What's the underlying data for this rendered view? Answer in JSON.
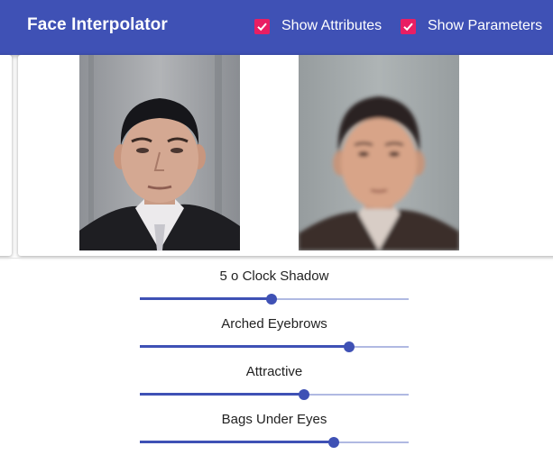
{
  "app": {
    "title": "Face Interpolator",
    "accent_color": "#3f51b5",
    "checkbox_color": "#e91e63"
  },
  "toggles": [
    {
      "label": "Show Attributes",
      "checked": true
    },
    {
      "label": "Show Parameters",
      "checked": true
    }
  ],
  "faces": {
    "original": "original-face-photo",
    "reconstruction": "reconstructed-face-image"
  },
  "attributes": [
    {
      "label": "5 o Clock Shadow",
      "value": 0.49
    },
    {
      "label": "Arched Eyebrows",
      "value": 0.78
    },
    {
      "label": "Attractive",
      "value": 0.61
    },
    {
      "label": "Bags Under Eyes",
      "value": 0.72
    }
  ]
}
